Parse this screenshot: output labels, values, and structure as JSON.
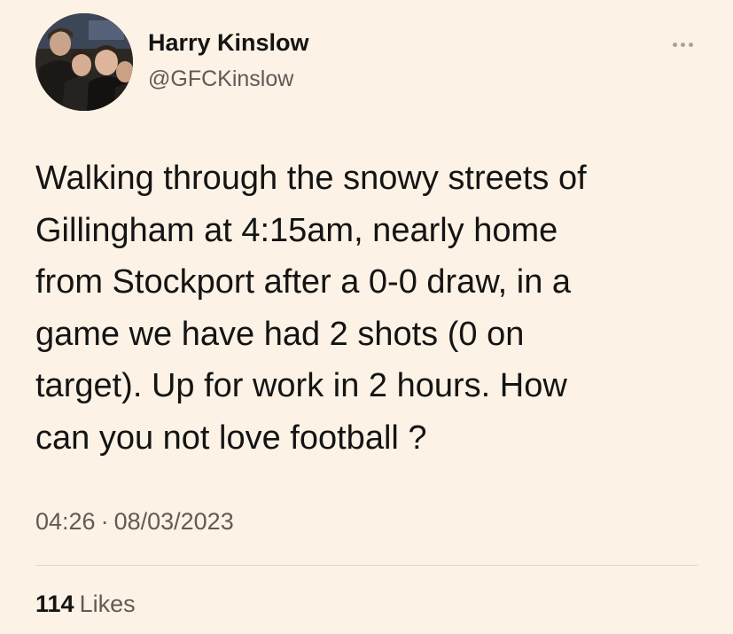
{
  "author": {
    "display_name": "Harry Kinslow",
    "handle": "@GFCKinslow",
    "avatar_icon": "profile-photo"
  },
  "menu": {
    "icon": "more-horizontal-icon"
  },
  "tweet": {
    "text": "Walking through the snowy streets of\nGillingham at 4:15am, nearly home\nfrom Stockport after a 0-0 draw, in a\ngame we have had 2 shots (0 on\ntarget). Up for work in 2 hours. How\ncan you not love football ?",
    "time": "04:26",
    "separator": "·",
    "date": "08/03/2023"
  },
  "stats": {
    "likes_count": "114",
    "likes_label": "Likes"
  },
  "colors": {
    "background": "#fcf2e5",
    "text": "#141414",
    "secondary_text": "#615b55",
    "divider": "#e3d7c8"
  }
}
